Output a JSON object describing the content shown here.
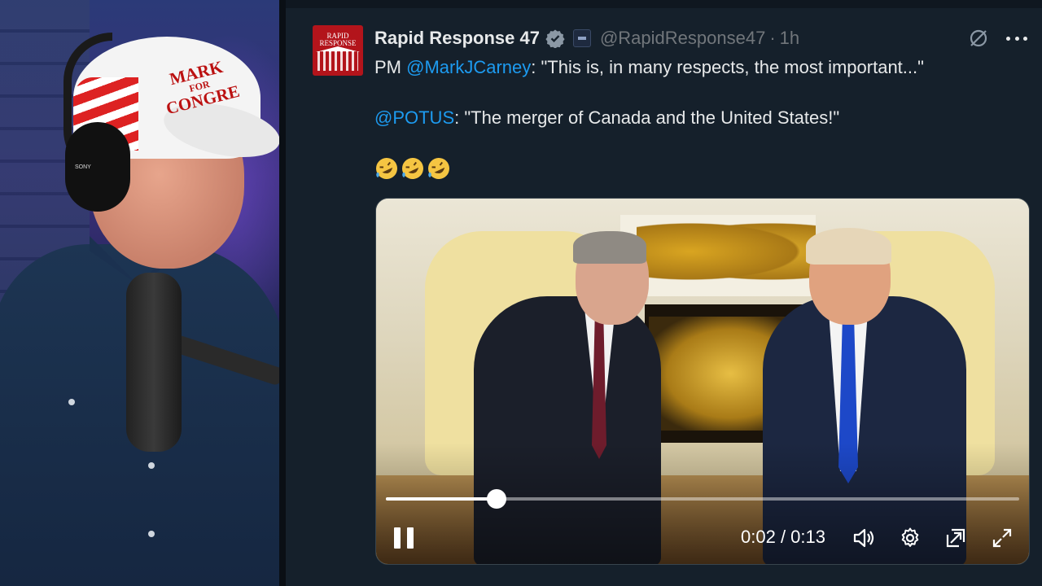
{
  "webcam": {
    "cap_text_line1": "MARK",
    "cap_text_line2": "FOR",
    "cap_text_line3": "CONGRE",
    "headphone_brand": "SONY"
  },
  "post": {
    "avatar_text_line1": "RAPID",
    "avatar_text_line2": "RESPONSE",
    "display_name": "Rapid Response 47",
    "handle": "@RapidResponse47",
    "separator": "·",
    "time": "1h",
    "line1_prefix": "PM ",
    "line1_mention": "@MarkJCarney",
    "line1_text": ": \"This is, in many respects, the most important...\"",
    "line2_mention": "@POTUS",
    "line2_text": ": \"The merger of Canada and the United States!\"",
    "emoji": [
      "🤣",
      "🤣",
      "🤣"
    ],
    "icons": {
      "verified": "verified-badge-icon",
      "grok": "grok-icon",
      "more": "more-icon"
    }
  },
  "video": {
    "current_time": "0:02",
    "duration": "0:13",
    "time_separator": " / ",
    "progress_fraction": 0.175,
    "icons": {
      "play_state": "pause-icon",
      "volume": "volume-icon",
      "settings": "gear-icon",
      "popout": "popout-icon",
      "fullscreen": "fullscreen-icon"
    }
  },
  "colors": {
    "background": "#15202b",
    "mention": "#1d9bf0",
    "text": "#e7e9ea",
    "muted": "#71767b",
    "verified": "#8b98a5"
  }
}
